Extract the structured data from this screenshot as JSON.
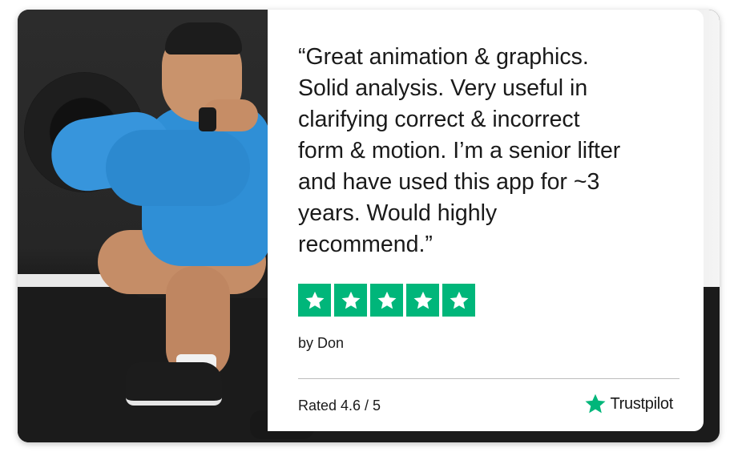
{
  "review": {
    "quote": "“Great animation & graphics.\nSolid analysis. Very useful in\nclarifying correct & incorrect\nform & motion. I’m a senior lifter\nand have used this app for ~3\nyears. Would highly\nrecommend.”",
    "stars": 5,
    "author": "by Don",
    "rating_text": "Rated 4.6 / 5",
    "brand_name": "Trustpilot"
  },
  "colors": {
    "star_green": "#00b67a",
    "shirt_blue": "#2f8fd6"
  },
  "icons": {
    "star": "star-icon",
    "brand_logo": "trustpilot-star-icon"
  }
}
